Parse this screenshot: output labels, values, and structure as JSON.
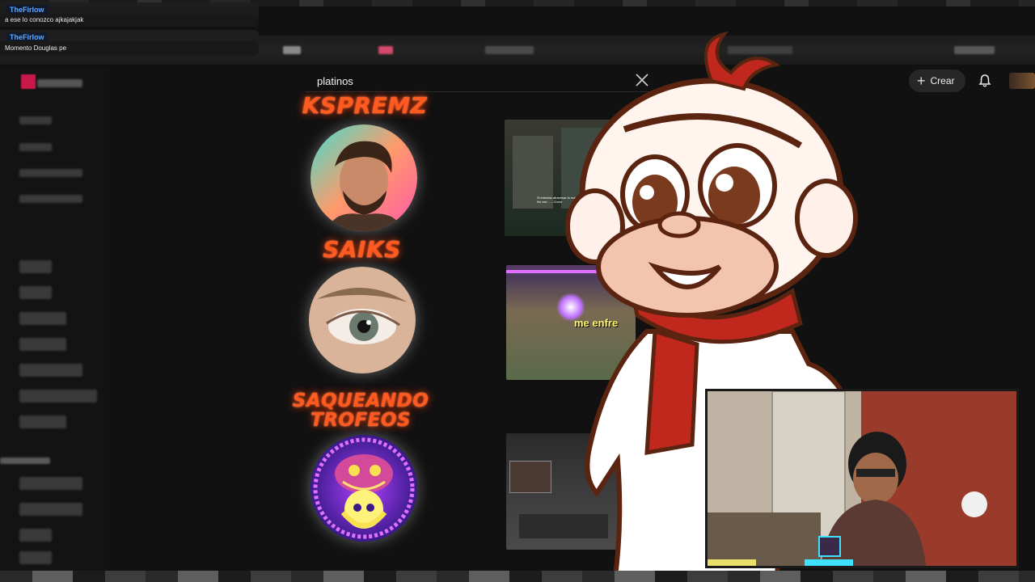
{
  "chat": [
    {
      "user": "TheFirlow",
      "message": "a ese lo conozco ajkajakjak"
    },
    {
      "user": "TheFirlow",
      "message": "Momento Douglas pe"
    }
  ],
  "header": {
    "search_value": "platinos",
    "create_label": "Crear"
  },
  "channels": [
    {
      "name": "KSPREMZ"
    },
    {
      "name": "SAIKS"
    },
    {
      "name_line1": "SAQUEANDO",
      "name_line2": "TROFEOS"
    }
  ],
  "thumbnails": [
    {
      "caption": "Si intentas atravesar la maldad ... pueble que mueres. No vas ... - Corvo"
    },
    {
      "caption": "me enfre"
    },
    {
      "caption": ""
    }
  ],
  "colors": {
    "channel_name": "#ff5a1f",
    "chat_username": "#5fa8ff",
    "background": "#0f0f0f"
  },
  "icons": [
    "close-icon",
    "plus-icon",
    "bell-icon"
  ]
}
